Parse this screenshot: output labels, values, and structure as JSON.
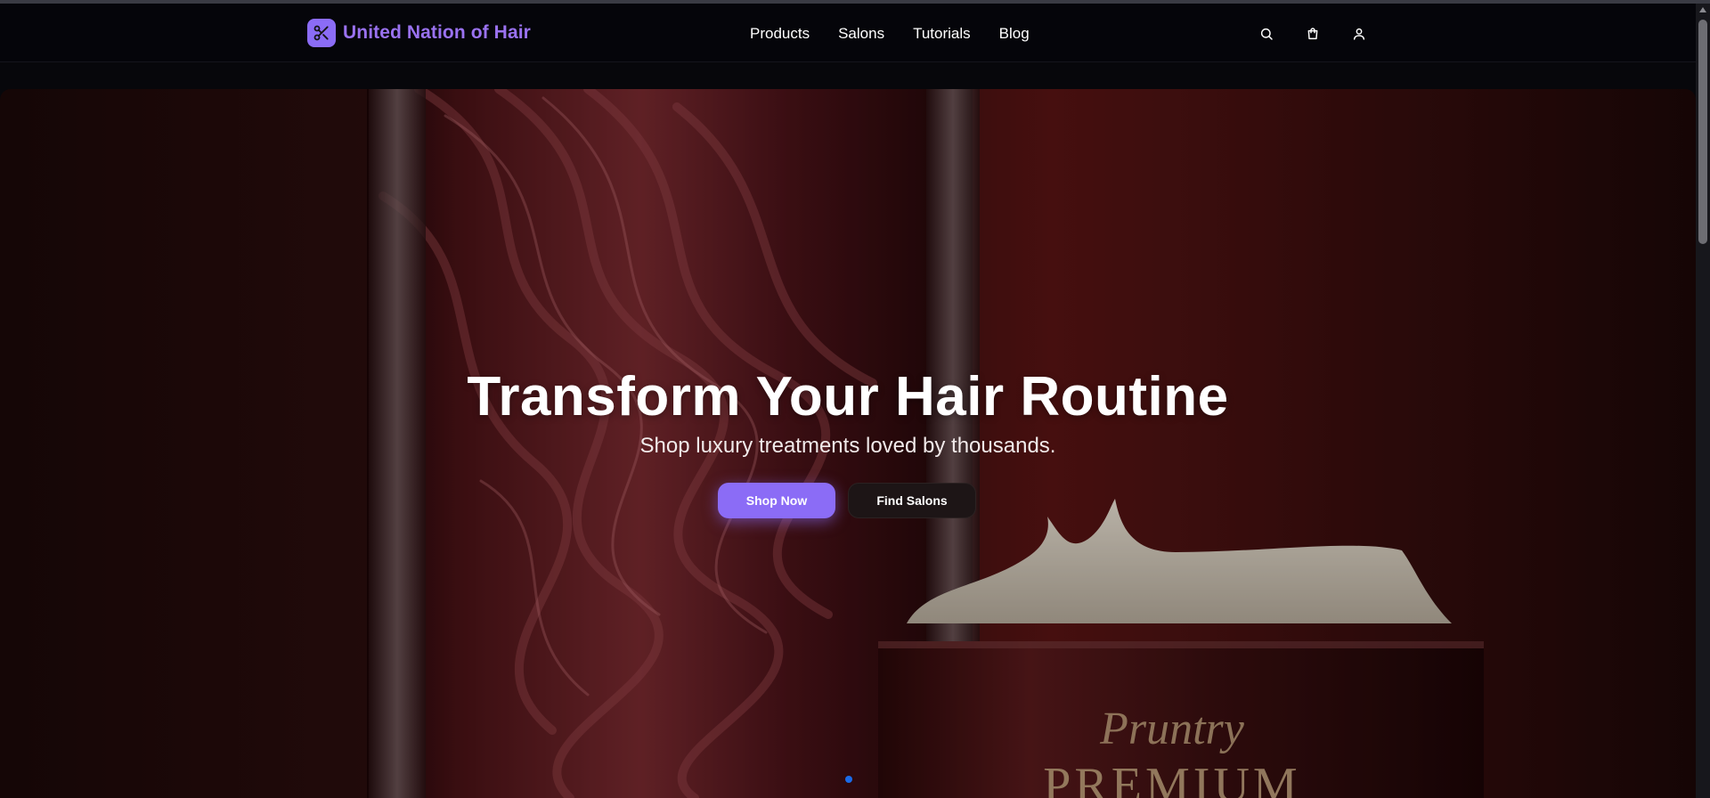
{
  "brand": {
    "name": "United Nation of Hair",
    "logo_icon": "scissors-icon",
    "accent_color": "#8b6cf6"
  },
  "nav": {
    "links": [
      "Products",
      "Salons",
      "Tutorials",
      "Blog"
    ],
    "icons": [
      "search-icon",
      "shopping-bag-icon",
      "user-icon"
    ]
  },
  "hero": {
    "title": "Transform Your Hair Routine",
    "subtitle": "Shop luxury treatments loved by thousands.",
    "primary_button": "Shop Now",
    "secondary_button": "Find Salons",
    "product_label_script": "Pruntry",
    "product_label_main": "PREMIUM",
    "carousel_active_color": "#1a6be8"
  }
}
